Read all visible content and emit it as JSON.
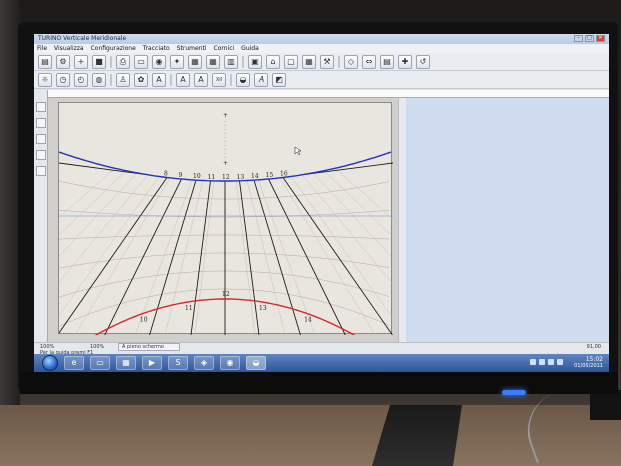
{
  "app": {
    "title": "TURINO Verticale Meridionale"
  },
  "window_controls": [
    "–",
    "□",
    "✕"
  ],
  "menu": [
    "File",
    "Visualizza",
    "Configurazione",
    "Tracciato",
    "Strumenti",
    "Cornici",
    "Guida"
  ],
  "toolbar1_icons": [
    "open-icon",
    "gear-icon",
    "plus-icon",
    "save-icon",
    "print-icon",
    "page-icon",
    "globe-icon",
    "compass-icon",
    "tile-icon",
    "tile-icon",
    "book-icon",
    "image-icon",
    "house-icon",
    "frame-icon",
    "grid-icon",
    "tool-icon",
    "plane-icon",
    "move-icon",
    "doc-icon",
    "cross-icon",
    "reset-icon"
  ],
  "toolbar2_icons": [
    "sun-icon",
    "clock-icon",
    "timer-icon",
    "globe-lines-icon",
    "person-icon",
    "plant-icon",
    "font-icon",
    "letter-icon",
    "letter-icon",
    "letter-icon",
    "sundial-icon",
    "text-icon",
    "color-icon"
  ],
  "toolbar2_labels": [
    "A",
    "A",
    "XII"
  ],
  "hour_labels_top": [
    "8",
    "9",
    "10",
    "11",
    "12",
    "13",
    "14",
    "15",
    "16"
  ],
  "hour_labels_bottom": [
    "10",
    "11",
    "12",
    "13",
    "14"
  ],
  "colors": {
    "top_curve": "#2533b8",
    "bottom_curve": "#d42a2a",
    "hour_lines": "#1c1c1c",
    "equinox_line": "#6a8ad6"
  },
  "status": {
    "zoom": "100%",
    "zoom2": "100%",
    "mode": "A pieno schermo",
    "coords": "91,00",
    "hint": "Per la guida premi F1"
  },
  "taskbar": {
    "time": "15:02",
    "date": "01/05/2011"
  }
}
